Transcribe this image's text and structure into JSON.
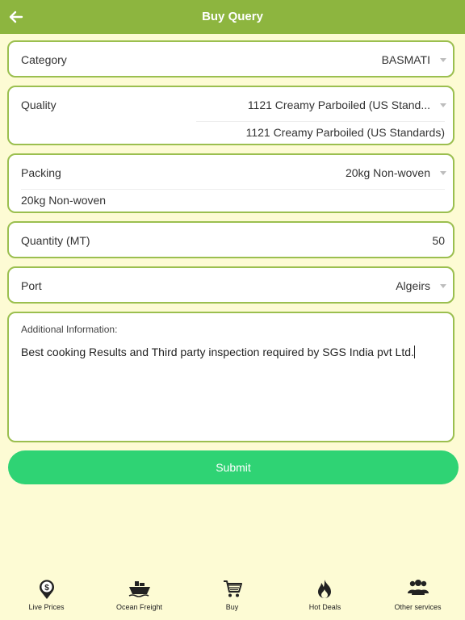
{
  "header": {
    "title": "Buy Query"
  },
  "form": {
    "category": {
      "label": "Category",
      "value": "BASMATI"
    },
    "quality": {
      "label": "Quality",
      "value": "1121 Creamy Parboiled (US Stand...",
      "selected": "1121 Creamy Parboiled (US Standards)"
    },
    "packing": {
      "label": "Packing",
      "value": "20kg Non-woven",
      "selected": "20kg Non-woven"
    },
    "quantity": {
      "label": "Quantity (MT)",
      "value": "50"
    },
    "port": {
      "label": "Port",
      "value": "Algeirs"
    },
    "additional": {
      "label": "Additional Information:",
      "text": "Best cooking Results and  Third party inspection required by SGS India pvt Ltd."
    },
    "submit_label": "Submit"
  },
  "tabs": [
    {
      "label": "Live Prices",
      "icon": "dollar-pin-icon"
    },
    {
      "label": "Ocean Freight",
      "icon": "ship-icon"
    },
    {
      "label": "Buy",
      "icon": "cart-icon"
    },
    {
      "label": "Hot Deals",
      "icon": "flame-icon"
    },
    {
      "label": "Other services",
      "icon": "people-icon"
    }
  ],
  "colors": {
    "header": "#8db53f",
    "background": "#fdfbd4",
    "border": "#9bbf4f",
    "submit": "#2fd374"
  }
}
